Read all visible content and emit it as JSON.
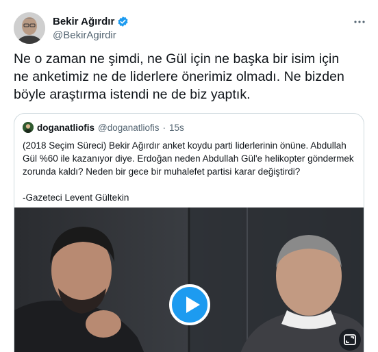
{
  "author": {
    "display_name": "Bekir Ağırdır",
    "handle": "@BekirAgirdir",
    "verified": true
  },
  "more_icon": "more-horizontal-icon",
  "tweet": {
    "lines": [
      "Ne o zaman ne şimdi, ne Gül için ne başka bir isim için",
      "ne anketimiz ne de liderlere önerimiz olmadı. Ne bizden",
      "böyle araştırma istendi ne de biz yaptık."
    ]
  },
  "quoted": {
    "display_name": "doganatliofis",
    "handle": "@doganatliofis",
    "separator": "·",
    "time": "15s",
    "lines": [
      "(2018 Seçim Süreci) Bekir Ağırdır anket koydu parti liderlerinin önüne. Abdullah",
      "Gül %60 ile kazanıyor diye. Erdoğan neden Abdullah Gül'e helikopter göndermek",
      "zorunda kaldı? Neden bir gece bir muhalefet partisi karar değiştirdi?"
    ],
    "signature": "-Gazeteci Levent Gültekin",
    "media": {
      "play_icon": "play-icon",
      "expand_icon": "expand-icon"
    }
  },
  "colors": {
    "accent": "#1d9bf0",
    "text": "#0f1419",
    "muted": "#536471",
    "border": "#cfd9de"
  }
}
